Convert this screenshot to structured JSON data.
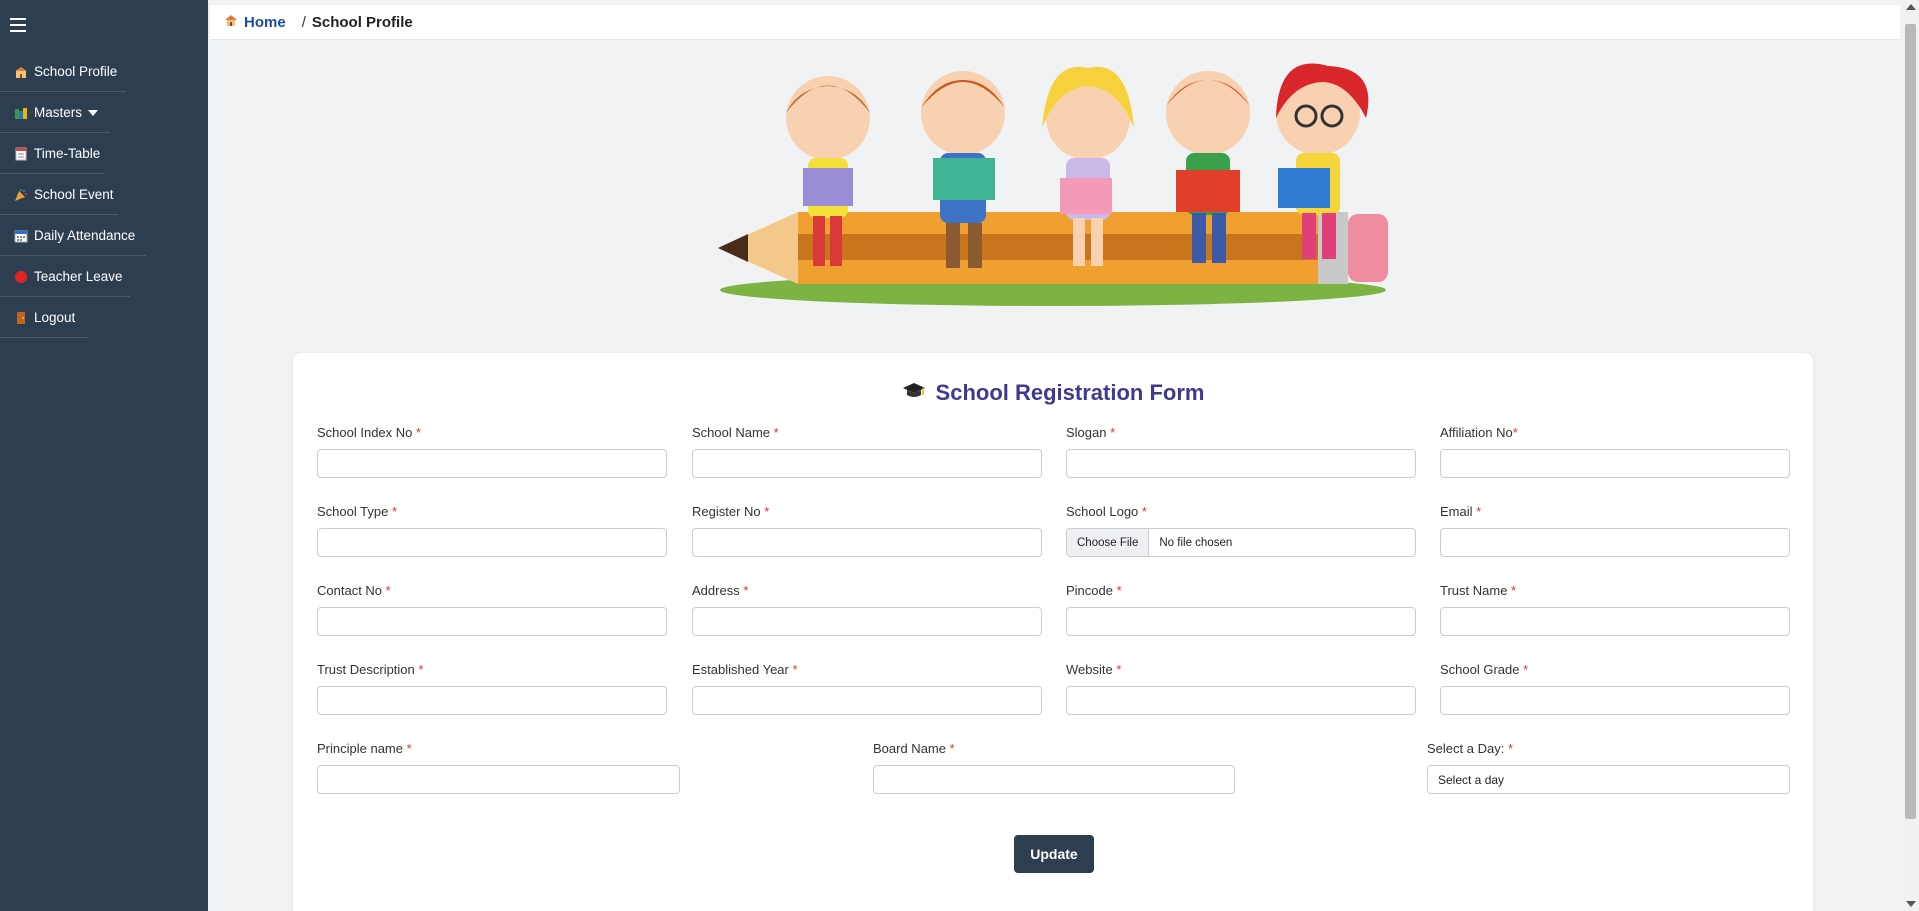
{
  "sidebar": {
    "items": [
      {
        "label": "School Profile",
        "icon": "school-icon"
      },
      {
        "label": "Masters",
        "icon": "books-icon"
      },
      {
        "label": "Time-Table",
        "icon": "timetable-icon"
      },
      {
        "label": "School Event",
        "icon": "party-popper-icon"
      },
      {
        "label": "Daily Attendance",
        "icon": "calendar-icon"
      },
      {
        "label": "Teacher Leave",
        "icon": "red-circle-icon"
      },
      {
        "label": "Logout",
        "icon": "door-icon"
      }
    ]
  },
  "breadcrumb": {
    "home": "Home",
    "separator": "/",
    "current": "School Profile"
  },
  "form": {
    "title": "School Registration Form",
    "required_mark": "*",
    "fields": {
      "school_index_no": "School Index No",
      "school_name": "School Name",
      "slogan": "Slogan",
      "affiliation_no": "Affiliation No",
      "school_type": "School Type",
      "register_no": "Register No",
      "school_logo": "School Logo",
      "email": "Email",
      "contact_no": "Contact No",
      "address": "Address",
      "pincode": "Pincode",
      "trust_name": "Trust Name",
      "trust_description": "Trust Description",
      "established_year": "Established Year",
      "website": "Website",
      "school_grade": "School Grade",
      "principle_name": "Principle name",
      "board_name": "Board Name",
      "select_day": "Select a Day:"
    },
    "file_input": {
      "button": "Choose File",
      "status": "No file chosen"
    },
    "select_day_value": "Select a day",
    "update_button": "Update"
  },
  "colors": {
    "sidebar_bg": "#2d3e50",
    "title": "#3f3a8f",
    "required": "#dd3333",
    "button": "#2d3e50"
  }
}
